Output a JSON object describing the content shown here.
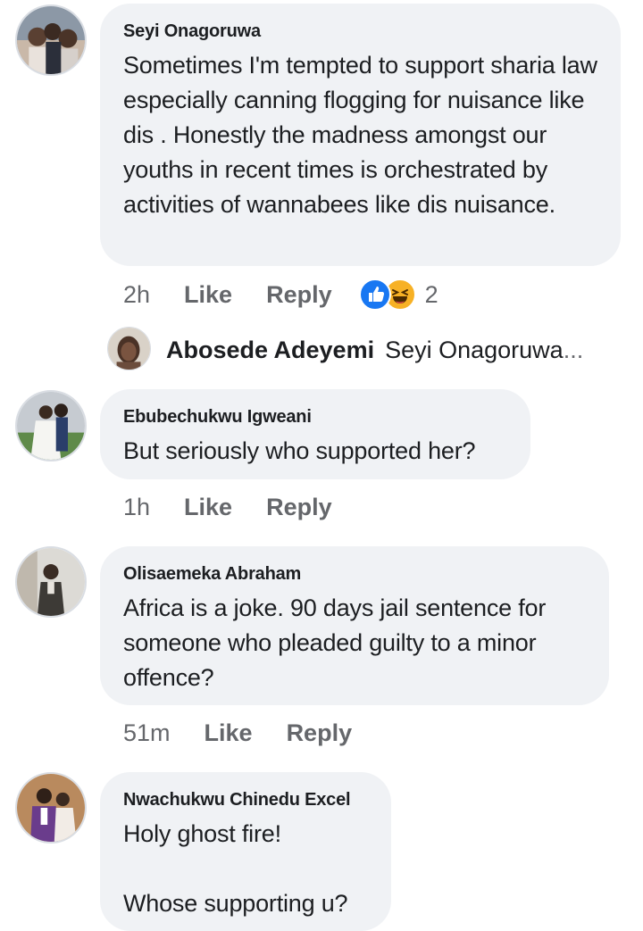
{
  "comments": [
    {
      "author": "Seyi Onagoruwa",
      "text": "Sometimes I'm tempted to support sharia law especially canning flogging for nuisance like dis . Honestly the madness amongst our youths in recent times is orchestrated by activities of wannabees like dis nuisance.",
      "time": "2h",
      "like_label": "Like",
      "reply_label": "Reply",
      "reaction_count": "2",
      "reactions": [
        "like-icon",
        "haha-icon"
      ],
      "reply_preview": {
        "author": "Abosede Adeyemi",
        "snippet": "Seyi Onagoruwa",
        "ellipsis": "..."
      }
    },
    {
      "author": "Ebubechukwu Igweani",
      "text": "But seriously who supported her?",
      "time": "1h",
      "like_label": "Like",
      "reply_label": "Reply"
    },
    {
      "author": "Olisaemeka Abraham",
      "text": "Africa is a joke. 90 days jail sentence for someone who pleaded guilty to a minor offence?",
      "time": "51m",
      "like_label": "Like",
      "reply_label": "Reply"
    },
    {
      "author": "Nwachukwu Chinedu Excel",
      "text": "Holy ghost fire!\n\nWhose supporting u?"
    }
  ],
  "colors": {
    "bubble": "#f0f2f5",
    "meta_text": "#65676b",
    "like_blue": "#1877f2",
    "haha_yellow": "#f7b125"
  }
}
